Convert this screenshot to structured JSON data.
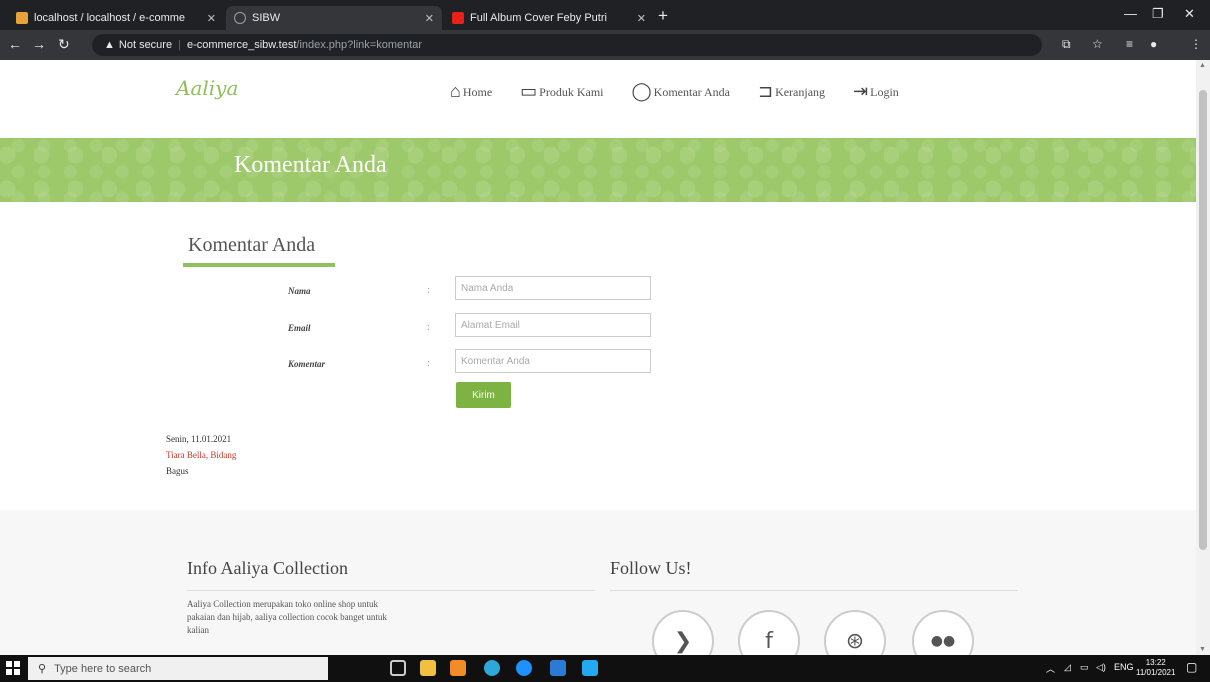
{
  "browser": {
    "tabs": [
      {
        "title": "localhost / localhost / e-comme"
      },
      {
        "title": "SIBW"
      },
      {
        "title": "Full Album Cover Feby Putri"
      }
    ],
    "url": {
      "security_label": "Not secure",
      "host": "e-commerce_sibw.test",
      "path": "/index.php?link=komentar"
    }
  },
  "site": {
    "logo": "Aaliya",
    "nav": [
      {
        "label": "Home",
        "icon": "home-icon"
      },
      {
        "label": "Produk Kami",
        "icon": "monitor-icon"
      },
      {
        "label": "Komentar Anda",
        "icon": "comment-icon"
      },
      {
        "label": "Keranjang",
        "icon": "cart-icon"
      },
      {
        "label": "Login",
        "icon": "login-icon"
      }
    ],
    "banner_title": "Komentar Anda"
  },
  "comment_form": {
    "title": "Komentar Anda",
    "name_label": "Nama",
    "name_placeholder": "Nama Anda",
    "email_label": "Email",
    "email_placeholder": "Alamat Email",
    "comment_label": "Komentar",
    "comment_placeholder": "Komentar Anda",
    "colon": ":",
    "submit_label": "Kirim"
  },
  "comments": [
    {
      "date": "Senin, 11.01.2021",
      "name": "Tiara Bella, Bidang",
      "text": "Bagus"
    }
  ],
  "footer": {
    "info_title": "Info Aaliya Collection",
    "info_text": "Aaliya Collection merupakan toko online shop untuk pakaian dan hijab, aaliya collection cocok banget untuk kalian",
    "follow_title": "Follow Us!",
    "social": [
      {
        "icon": "twitter-icon",
        "glyph": "❯"
      },
      {
        "icon": "facebook-icon",
        "glyph": "f"
      },
      {
        "icon": "dribbble-icon",
        "glyph": "⊛"
      },
      {
        "icon": "flickr-icon",
        "glyph": "●●"
      }
    ]
  },
  "taskbar": {
    "search_placeholder": "Type here to search",
    "language": "ENG",
    "time": "13:22",
    "date": "11/01/2021"
  },
  "colors": {
    "brand_green": "#9ec96b",
    "button_green": "#7cb342"
  }
}
